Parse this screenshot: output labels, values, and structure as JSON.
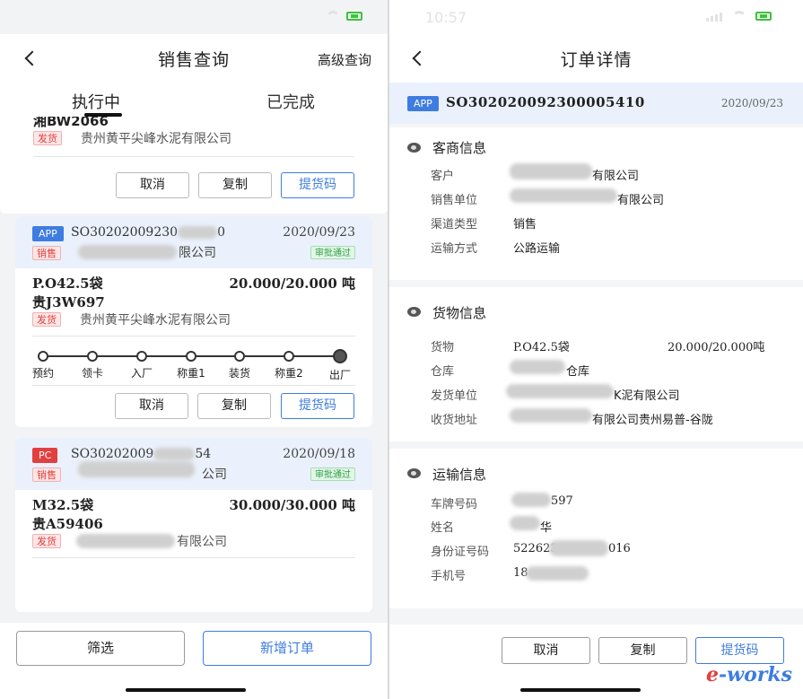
{
  "left": {
    "nav": {
      "title": "销售查询",
      "advanced": "高级查询"
    },
    "tabs": {
      "active": "执行中",
      "other": "已完成"
    },
    "card0": {
      "plate": "湘BW2066",
      "ship_tag": "发货",
      "ship_name": "贵州黄平尖峰水泥有限公司",
      "buttons": {
        "cancel": "取消",
        "copy": "复制",
        "code": "提货码"
      }
    },
    "card1": {
      "badge": "APP",
      "order_no": "SO30202009230",
      "order_no_tail": "0",
      "date": "2020/09/23",
      "type_tag": "销售",
      "customer_tail": "限公司",
      "status": "审批通过",
      "product": "P.O42.5袋",
      "qty": "20.000/20.000 吨",
      "plate": "贵J3W697",
      "ship_tag": "发货",
      "ship_name": "贵州黄平尖峰水泥有限公司",
      "steps": [
        "预约",
        "领卡",
        "入厂",
        "称重1",
        "装货",
        "称重2",
        "出厂"
      ],
      "buttons": {
        "cancel": "取消",
        "copy": "复制",
        "code": "提货码"
      }
    },
    "card2": {
      "badge": "PC",
      "order_no": "SO30202009",
      "order_no_tail": "54",
      "date": "2020/09/18",
      "type_tag": "销售",
      "customer_tail": "公司",
      "status": "审批通过",
      "product": "M32.5袋",
      "qty": "30.000/30.000 吨",
      "plate": "贵A59406",
      "ship_tag": "发货",
      "ship_name_tail": "有限公司"
    },
    "bottom": {
      "filter": "筛选",
      "new_order": "新增订单"
    }
  },
  "right": {
    "status_time": "10:57",
    "nav": {
      "title": "订单详情"
    },
    "order": {
      "badge": "APP",
      "no": "SO302020092300005410",
      "date": "2020/09/23"
    },
    "merchant": {
      "title": "客商信息",
      "rows": [
        {
          "label": "客户",
          "value": "有限公司"
        },
        {
          "label": "销售单位",
          "value": "有限公司"
        },
        {
          "label": "渠道类型",
          "value": "销售"
        },
        {
          "label": "运输方式",
          "value": "公路运输"
        }
      ]
    },
    "goods": {
      "title": "货物信息",
      "rows": [
        {
          "label": "货物",
          "value": "P.O42.5袋",
          "value2": "20.000/20.000吨"
        },
        {
          "label": "仓库",
          "value": "仓库"
        },
        {
          "label": "发货单位",
          "value": "K泥有限公司"
        },
        {
          "label": "收货地址",
          "value": "有限公司贵州易普-谷陇"
        }
      ]
    },
    "transport": {
      "title": "运输信息",
      "rows": [
        {
          "label": "车牌号码",
          "value": "597"
        },
        {
          "label": "姓名",
          "value": "华"
        },
        {
          "label": "身份证号码",
          "value": "522623",
          "value2": "016"
        },
        {
          "label": "手机号",
          "value": "18"
        }
      ]
    },
    "buttons": {
      "cancel": "取消",
      "copy": "复制",
      "code": "提货码"
    }
  },
  "watermark": {
    "prefix": "e",
    "rest": "-works"
  },
  "colors": {
    "accent": "#3e7ce0",
    "red": "#e1403f",
    "green": "#2fa048"
  }
}
